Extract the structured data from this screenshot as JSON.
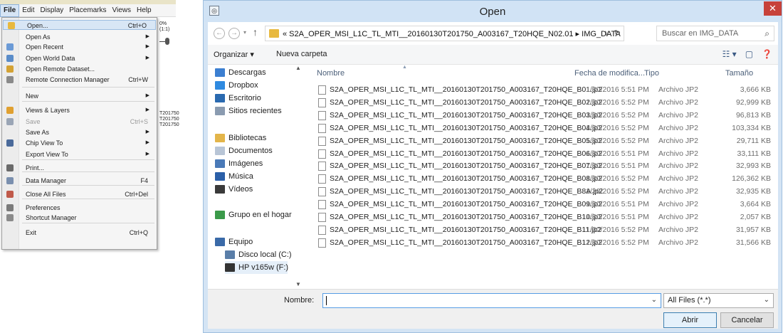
{
  "app": {
    "menubar": [
      "File",
      "Edit",
      "Display",
      "Placemarks",
      "Views",
      "Help"
    ],
    "background_texts": [
      "0% (1:1)",
      "T201750",
      "T201750",
      "T201750"
    ],
    "file_menu": [
      {
        "label": "Open...",
        "shortcut": "Ctrl+O",
        "arrow": "",
        "icon": "open-folder-icon",
        "icon_color": "#e8b93f"
      },
      {
        "label": "Open As",
        "shortcut": "",
        "arrow": "▶",
        "icon": "",
        "icon_color": ""
      },
      {
        "label": "Open Recent",
        "shortcut": "",
        "arrow": "▶",
        "icon": "recent-icon",
        "icon_color": "#6b9ad6"
      },
      {
        "label": "Open World Data",
        "shortcut": "",
        "arrow": "▶",
        "icon": "world-data-icon",
        "icon_color": "#5a8cc9"
      },
      {
        "label": "Open Remote Dataset...",
        "shortcut": "",
        "arrow": "",
        "icon": "remote-dataset-icon",
        "icon_color": "#d3a234"
      },
      {
        "label": "Remote Connection Manager",
        "shortcut": "Ctrl+W",
        "arrow": "",
        "icon": "connection-manager-icon",
        "icon_color": "#8a8a8a"
      },
      {
        "label": "New",
        "shortcut": "",
        "arrow": "▶",
        "icon": "",
        "icon_color": ""
      },
      {
        "label": "Views & Layers",
        "shortcut": "",
        "arrow": "▶",
        "icon": "views-layers-icon",
        "icon_color": "#e0a030"
      },
      {
        "label": "Save",
        "shortcut": "Ctrl+S",
        "arrow": "",
        "icon": "save-icon",
        "icon_color": "#9aa5b5"
      },
      {
        "label": "Save As",
        "shortcut": "",
        "arrow": "▶",
        "icon": "",
        "icon_color": ""
      },
      {
        "label": "Chip View To",
        "shortcut": "",
        "arrow": "▶",
        "icon": "chip-view-icon",
        "icon_color": "#4a6a9a"
      },
      {
        "label": "Export View To",
        "shortcut": "",
        "arrow": "▶",
        "icon": "",
        "icon_color": ""
      },
      {
        "label": "Print...",
        "shortcut": "",
        "arrow": "",
        "icon": "print-icon",
        "icon_color": "#6a6a6a"
      },
      {
        "label": "Data Manager",
        "shortcut": "F4",
        "arrow": "",
        "icon": "data-manager-icon",
        "icon_color": "#7a8fae"
      },
      {
        "label": "Close All Files",
        "shortcut": "Ctrl+Del",
        "arrow": "",
        "icon": "close-files-icon",
        "icon_color": "#c05a4a"
      },
      {
        "label": "Preferences",
        "shortcut": "",
        "arrow": "",
        "icon": "preferences-icon",
        "icon_color": "#7a7a7a"
      },
      {
        "label": "Shortcut Manager",
        "shortcut": "",
        "arrow": "",
        "icon": "shortcut-manager-icon",
        "icon_color": "#8a8a8a"
      },
      {
        "label": "Exit",
        "shortcut": "Ctrl+Q",
        "arrow": "",
        "icon": "",
        "icon_color": ""
      }
    ]
  },
  "dialog": {
    "title": "Open",
    "address_path": "« S2A_OPER_MSI_L1C_TL_MTI__20160130T201750_A003167_T20HQE_N02.01 ▸ IMG_DATA",
    "search_placeholder": "Buscar en IMG_DATA",
    "toolbar": {
      "organize": "Organizar ▾",
      "new_folder": "Nueva carpeta"
    },
    "nav_items": [
      {
        "label": "Descargas",
        "icon": "downloads-icon",
        "color": "#3c7fd1"
      },
      {
        "label": "Dropbox",
        "icon": "dropbox-icon",
        "color": "#2f8ae0"
      },
      {
        "label": "Escritorio",
        "icon": "desktop-icon",
        "color": "#2a6ab0"
      },
      {
        "label": "Sitios recientes",
        "icon": "recent-places-icon",
        "color": "#8a9bb0"
      },
      {
        "label": "Bibliotecas",
        "icon": "libraries-icon",
        "color": "#e3b54a"
      },
      {
        "label": "Documentos",
        "icon": "documents-icon",
        "color": "#b8c5d6"
      },
      {
        "label": "Imágenes",
        "icon": "pictures-icon",
        "color": "#4a7ab8"
      },
      {
        "label": "Música",
        "icon": "music-icon",
        "color": "#2b5fa8"
      },
      {
        "label": "Vídeos",
        "icon": "videos-icon",
        "color": "#3a3a3a"
      },
      {
        "label": "Grupo en el hogar",
        "icon": "homegroup-icon",
        "color": "#3b9a4a"
      },
      {
        "label": "Equipo",
        "icon": "computer-icon",
        "color": "#3a6aa8"
      },
      {
        "label": "Disco local (C:)",
        "icon": "local-disk-icon",
        "color": "#5a7ea8"
      },
      {
        "label": "HP v165w (F:)",
        "icon": "usb-drive-icon",
        "color": "#333333"
      }
    ],
    "columns": {
      "name": "Nombre",
      "date": "Fecha de modifica...",
      "type": "Tipo",
      "size": "Tamaño"
    },
    "files": [
      {
        "name": "S2A_OPER_MSI_L1C_TL_MTI__20160130T201750_A003167_T20HQE_B01.jp2",
        "date": "1/30/2016 5:51 PM",
        "type": "Archivo JP2",
        "size": "3,666 KB"
      },
      {
        "name": "S2A_OPER_MSI_L1C_TL_MTI__20160130T201750_A003167_T20HQE_B02.jp2",
        "date": "1/30/2016 5:52 PM",
        "type": "Archivo JP2",
        "size": "92,999 KB"
      },
      {
        "name": "S2A_OPER_MSI_L1C_TL_MTI__20160130T201750_A003167_T20HQE_B03.jp2",
        "date": "1/30/2016 5:52 PM",
        "type": "Archivo JP2",
        "size": "96,813 KB"
      },
      {
        "name": "S2A_OPER_MSI_L1C_TL_MTI__20160130T201750_A003167_T20HQE_B04.jp2",
        "date": "1/30/2016 5:52 PM",
        "type": "Archivo JP2",
        "size": "103,334 KB"
      },
      {
        "name": "S2A_OPER_MSI_L1C_TL_MTI__20160130T201750_A003167_T20HQE_B05.jp2",
        "date": "1/30/2016 5:52 PM",
        "type": "Archivo JP2",
        "size": "29,711 KB"
      },
      {
        "name": "S2A_OPER_MSI_L1C_TL_MTI__20160130T201750_A003167_T20HQE_B06.jp2",
        "date": "1/30/2016 5:51 PM",
        "type": "Archivo JP2",
        "size": "33,111 KB"
      },
      {
        "name": "S2A_OPER_MSI_L1C_TL_MTI__20160130T201750_A003167_T20HQE_B07.jp2",
        "date": "1/30/2016 5:51 PM",
        "type": "Archivo JP2",
        "size": "32,993 KB"
      },
      {
        "name": "S2A_OPER_MSI_L1C_TL_MTI__20160130T201750_A003167_T20HQE_B08.jp2",
        "date": "1/30/2016 5:52 PM",
        "type": "Archivo JP2",
        "size": "126,362 KB"
      },
      {
        "name": "S2A_OPER_MSI_L1C_TL_MTI__20160130T201750_A003167_T20HQE_B8A.jp2",
        "date": "1/30/2016 5:52 PM",
        "type": "Archivo JP2",
        "size": "32,935 KB"
      },
      {
        "name": "S2A_OPER_MSI_L1C_TL_MTI__20160130T201750_A003167_T20HQE_B09.jp2",
        "date": "1/30/2016 5:51 PM",
        "type": "Archivo JP2",
        "size": "3,664 KB"
      },
      {
        "name": "S2A_OPER_MSI_L1C_TL_MTI__20160130T201750_A003167_T20HQE_B10.jp2",
        "date": "1/30/2016 5:51 PM",
        "type": "Archivo JP2",
        "size": "2,057 KB"
      },
      {
        "name": "S2A_OPER_MSI_L1C_TL_MTI__20160130T201750_A003167_T20HQE_B11.jp2",
        "date": "1/30/2016 5:52 PM",
        "type": "Archivo JP2",
        "size": "31,957 KB"
      },
      {
        "name": "S2A_OPER_MSI_L1C_TL_MTI__20160130T201750_A003167_T20HQE_B12.jp2",
        "date": "1/30/2016 5:52 PM",
        "type": "Archivo JP2",
        "size": "31,566 KB"
      }
    ],
    "file_name_label": "Nombre:",
    "file_name_value": "",
    "filter": "All Files (*.*)",
    "open_button": "Abrir",
    "cancel_button": "Cancelar"
  },
  "colors": {
    "accent": "#569de5",
    "close": "#c7423a",
    "titlebar": "#d1e3f5",
    "highlight": "#d8e6f5"
  }
}
